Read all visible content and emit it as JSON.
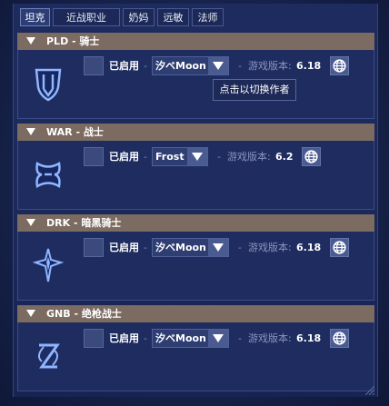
{
  "tabs": [
    {
      "label": "坦克",
      "active": true
    },
    {
      "label": "近战职业",
      "active": false
    },
    {
      "label": "奶妈",
      "active": false
    },
    {
      "label": "远敏",
      "active": false
    },
    {
      "label": "法师",
      "active": false
    }
  ],
  "sections": [
    {
      "title": "PLD - 骑士",
      "icon": "paladin-shield-icon",
      "enabled_label": "已启用",
      "author": "汐ベMoon",
      "version_label": "游戏版本:",
      "version": "6.18",
      "checked": false
    },
    {
      "title": "WAR - 战士",
      "icon": "warrior-axe-icon",
      "enabled_label": "已启用",
      "author": "Frost",
      "version_label": "游戏版本:",
      "version": "6.2",
      "checked": false
    },
    {
      "title": "DRK - 暗黑骑士",
      "icon": "darkknight-star-icon",
      "enabled_label": "已启用",
      "author": "汐ベMoon",
      "version_label": "游戏版本:",
      "version": "6.18",
      "checked": false
    },
    {
      "title": "GNB - 绝枪战士",
      "icon": "gunbreaker-blade-icon",
      "enabled_label": "已启用",
      "author": "汐ベMoon",
      "version_label": "游戏版本:",
      "version": "6.18",
      "checked": false
    }
  ],
  "tooltip": "点击以切换作者",
  "colors": {
    "header_bg": "#7c6b61",
    "panel_bg": "#1e2c60",
    "icon_blue": "#8fb6ff"
  }
}
